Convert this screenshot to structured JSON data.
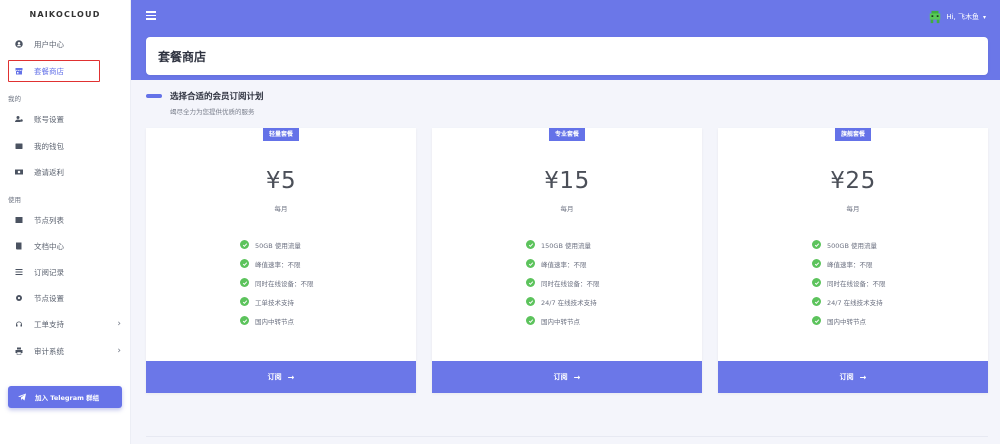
{
  "sidebar": {
    "brand": "NAIKOCLOUD",
    "items": [
      {
        "label": "用户中心",
        "icon": "user-circle-icon"
      },
      {
        "label": "套餐商店",
        "icon": "store-icon"
      },
      {
        "label": "账号设置",
        "icon": "user-cog-icon"
      },
      {
        "label": "我的钱包",
        "icon": "wallet-icon"
      },
      {
        "label": "邀请返利",
        "icon": "money-icon"
      },
      {
        "label": "节点列表",
        "icon": "list-icon"
      },
      {
        "label": "文档中心",
        "icon": "book-icon"
      },
      {
        "label": "订阅记录",
        "icon": "sliders-icon"
      },
      {
        "label": "节点设置",
        "icon": "gear-icon"
      },
      {
        "label": "工单支持",
        "icon": "headset-icon"
      },
      {
        "label": "审计系统",
        "icon": "printer-icon"
      }
    ],
    "sections": {
      "account": "我的",
      "usage": "使用"
    },
    "telegram_button": "加入 Telegram 群组"
  },
  "header": {
    "greeting": "Hi, 飞木鱼"
  },
  "page": {
    "title": "套餐商店",
    "section_title": "选择合适的会员订阅计划",
    "section_subtitle": "竭尽全力为您提供优质的服务"
  },
  "plans": [
    {
      "badge": "轻量套餐",
      "price": "¥5",
      "period": "每月",
      "features": [
        "50GB 使用流量",
        "峰值速率：不限",
        "同时在线设备：不限",
        "工单技术支持",
        "国内中转节点"
      ],
      "button": "订阅"
    },
    {
      "badge": "专业套餐",
      "price": "¥15",
      "period": "每月",
      "features": [
        "150GB 使用流量",
        "峰值速率：不限",
        "同时在线设备：不限",
        "24/7 在线技术支持",
        "国内中转节点"
      ],
      "button": "订阅"
    },
    {
      "badge": "旗舰套餐",
      "price": "¥25",
      "period": "每月",
      "features": [
        "500GB 使用流量",
        "峰值速率：不限",
        "同时在线设备：不限",
        "24/7 在线技术支持",
        "国内中转节点"
      ],
      "button": "订阅"
    }
  ],
  "colors": {
    "accent": "#6b77e8",
    "check": "#5cc35c",
    "highlight_box": "#e03131"
  }
}
